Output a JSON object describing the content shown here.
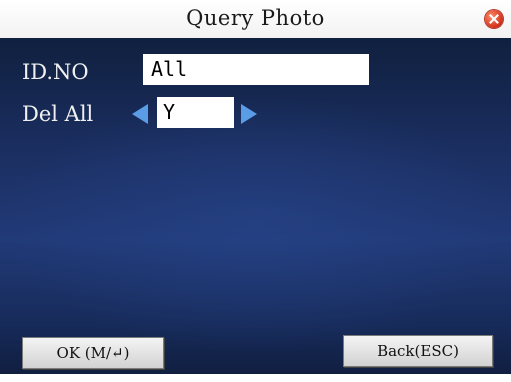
{
  "window": {
    "title": "Query Photo",
    "close_icon": "close-icon"
  },
  "form": {
    "id_no": {
      "label": "ID.NO",
      "value": "All"
    },
    "del_all": {
      "label": "Del All",
      "value": "Y",
      "left_icon": "arrow-left-icon",
      "right_icon": "arrow-right-icon"
    }
  },
  "buttons": {
    "ok_label": "OK (M/↵)",
    "back_label": "Back(ESC)"
  },
  "colors": {
    "panel_blue": "#1b2f62",
    "arrow_blue": "#5a9ce6",
    "close_red": "#d0301a"
  }
}
